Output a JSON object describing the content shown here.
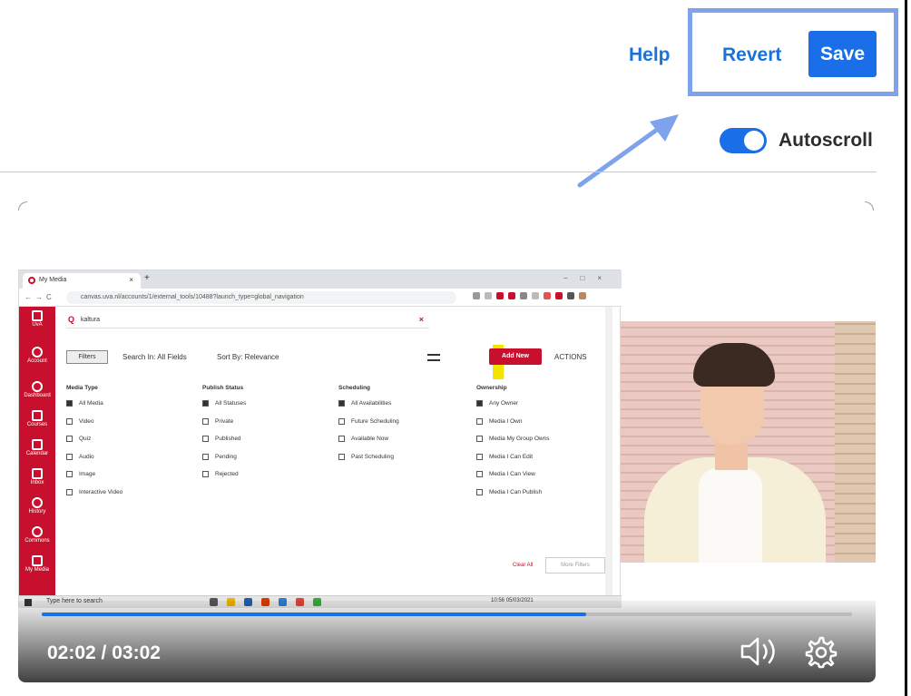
{
  "header": {
    "help_label": "Help",
    "revert_label": "Revert",
    "save_label": "Save",
    "autoscroll_label": "Autoscroll",
    "autoscroll_on": true
  },
  "colors": {
    "accent": "#1a6fe8",
    "link": "#1a73d9",
    "callout": "#7ea2ec",
    "canvas_red": "#c8102e"
  },
  "player": {
    "time_display": "02:02 / 03:02",
    "progress_fraction": 0.672,
    "volume_icon": "volume-icon",
    "settings_icon": "gear-icon"
  },
  "embedded": {
    "tab_title": "My Media",
    "url": "canvas.uva.nl/accounts/1/external_tools/10488?launch_type=global_navigation",
    "sidebar": [
      "UvA",
      "Account",
      "Dashboard",
      "Courses",
      "Calendar",
      "Inbox",
      "History",
      "Commons",
      "My Media"
    ],
    "search_value": "kaltura",
    "filters_label": "Filters",
    "search_in": "Search In: All Fields",
    "sort_by": "Sort By: Relevance",
    "add_new": "Add New",
    "actions": "ACTIONS",
    "columns": [
      {
        "header": "Media Type",
        "options": [
          [
            "All Media",
            true
          ],
          [
            "Video",
            false
          ],
          [
            "Quiz",
            false
          ],
          [
            "Audio",
            false
          ],
          [
            "Image",
            false
          ],
          [
            "Interactive Video",
            false
          ]
        ]
      },
      {
        "header": "Publish Status",
        "options": [
          [
            "All Statuses",
            true
          ],
          [
            "Private",
            false
          ],
          [
            "Published",
            false
          ],
          [
            "Pending",
            false
          ],
          [
            "Rejected",
            false
          ]
        ]
      },
      {
        "header": "Scheduling",
        "options": [
          [
            "All Availabilities",
            true
          ],
          [
            "Future Scheduling",
            false
          ],
          [
            "Available Now",
            false
          ],
          [
            "Past Scheduling",
            false
          ]
        ]
      },
      {
        "header": "Ownership",
        "options": [
          [
            "Any Owner",
            true
          ],
          [
            "Media I Own",
            false
          ],
          [
            "Media My Group Owns",
            false
          ],
          [
            "Media I Can Edit",
            false
          ],
          [
            "Media I Can View",
            false
          ],
          [
            "Media I Can Publish",
            false
          ]
        ]
      }
    ],
    "clear_all": "Clear All",
    "more_filters": "More Filters",
    "taskbar_search": "Type here to search",
    "taskbar_time": "10:56",
    "taskbar_date": "05/03/2021"
  }
}
